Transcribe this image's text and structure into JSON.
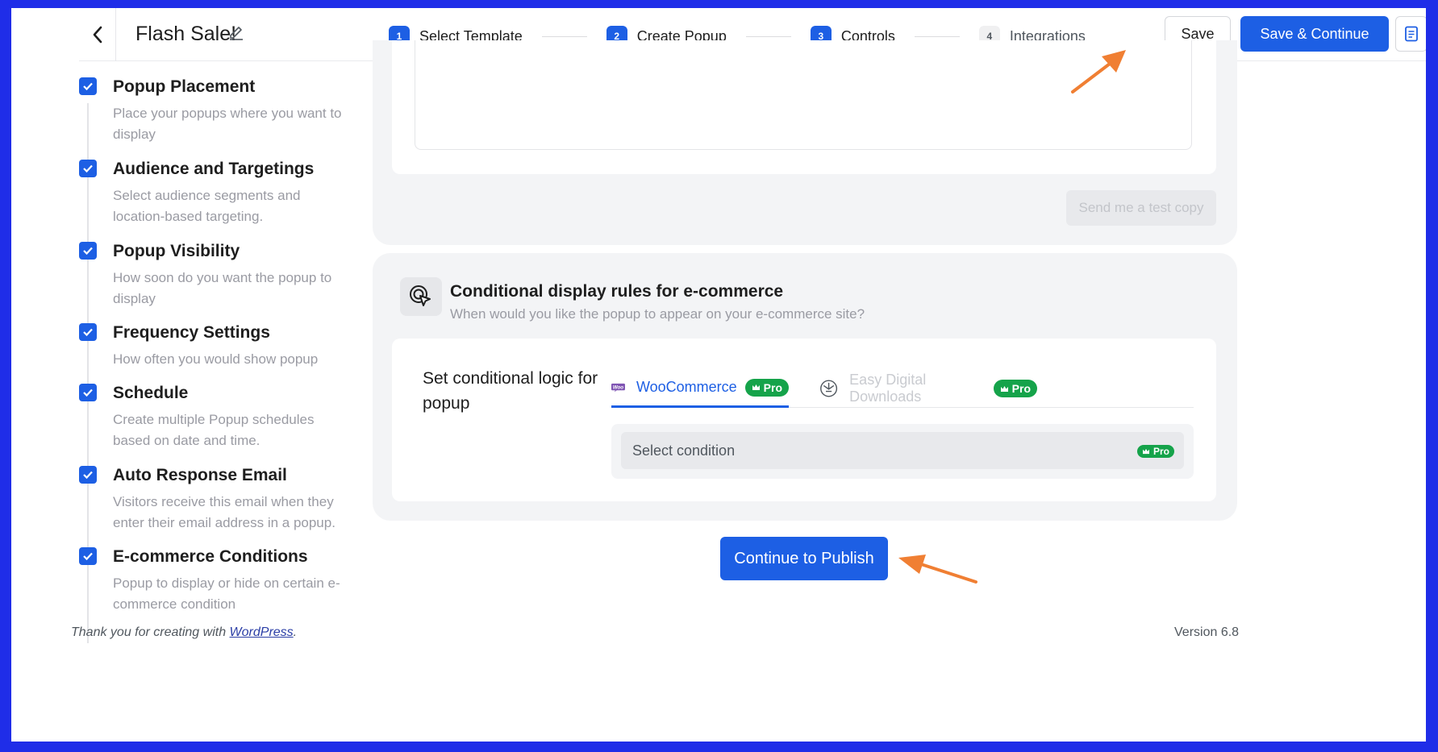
{
  "header": {
    "title": "Flash Sale!",
    "steps": [
      {
        "num": "1",
        "label": "Select Template"
      },
      {
        "num": "2",
        "label": "Create Popup"
      },
      {
        "num": "3",
        "label": "Controls"
      },
      {
        "num": "4",
        "label": "Integrations"
      }
    ],
    "save_label": "Save",
    "save_continue_label": "Save & Continue"
  },
  "sidebar": {
    "items": [
      {
        "title": "Popup Placement",
        "desc": "Place your popups where you want to display"
      },
      {
        "title": "Audience and Targetings",
        "desc": "Select audience segments and location-based targeting."
      },
      {
        "title": "Popup Visibility",
        "desc": "How soon do you want the popup to display"
      },
      {
        "title": "Frequency Settings",
        "desc": "How often you would show popup"
      },
      {
        "title": "Schedule",
        "desc": "Create multiple Popup schedules based on date and time."
      },
      {
        "title": "Auto Response Email",
        "desc": "Visitors receive this email when they enter their email address in a popup."
      },
      {
        "title": "E-commerce Conditions",
        "desc": "Popup to display or hide on certain e-commerce condition"
      }
    ]
  },
  "email": {
    "test_copy_label": "Send me a test copy"
  },
  "ecommerce": {
    "title": "Conditional display rules for e-commerce",
    "desc": "When would you like the popup to appear on your e-commerce site?",
    "logic_label": "Set conditional logic for popup",
    "tabs": [
      {
        "label": "WooCommerce",
        "badge": "Pro",
        "logo": "Woo"
      },
      {
        "label": "Easy Digital Downloads",
        "badge": "Pro"
      }
    ],
    "select_placeholder": "Select condition",
    "select_badge": "Pro"
  },
  "publish_label": "Continue to Publish",
  "footer": {
    "thanks_prefix": "Thank you for creating with ",
    "thanks_link": "WordPress",
    "thanks_suffix": ".",
    "version": "Version 6.8"
  },
  "colors": {
    "accent": "#1d5fe4",
    "pro_badge": "#15a34a",
    "frame_border": "#1f2de8",
    "annotation_arrow": "#f07f33"
  }
}
